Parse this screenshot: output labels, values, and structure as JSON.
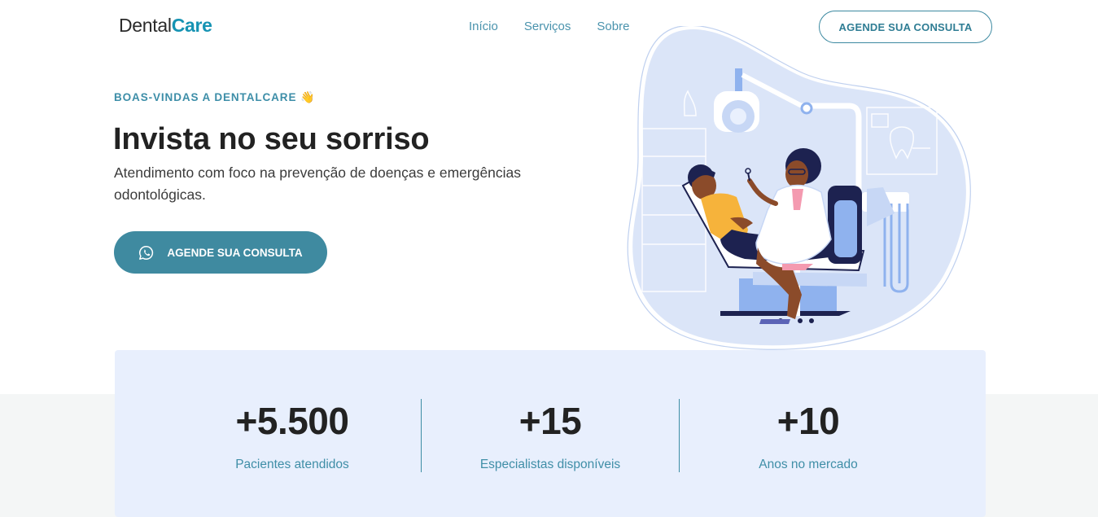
{
  "header": {
    "logo_light": "Dental",
    "logo_bold": "Care",
    "nav": [
      "Início",
      "Serviços",
      "Sobre"
    ],
    "cta": "AGENDE SUA CONSULTA"
  },
  "hero": {
    "eyebrow": "BOAS-VINDAS A DENTALCARE",
    "eyebrow_emoji": "👋",
    "title": "Invista no seu sorriso",
    "subtitle": "Atendimento com foco na prevenção de doenças e emergências odontológicas.",
    "cta": "AGENDE SUA CONSULTA",
    "cta_icon": "whatsapp-icon"
  },
  "stats": [
    {
      "value": "+5.500",
      "label": "Pacientes atendidos"
    },
    {
      "value": "+15",
      "label": "Especialistas disponíveis"
    },
    {
      "value": "+10",
      "label": "Anos no mercado"
    }
  ],
  "colors": {
    "brand": "#1693b3",
    "accent": "#3f8aa0",
    "stats_bg": "#e8effd",
    "illustration_blob": "#dbe5f8"
  }
}
